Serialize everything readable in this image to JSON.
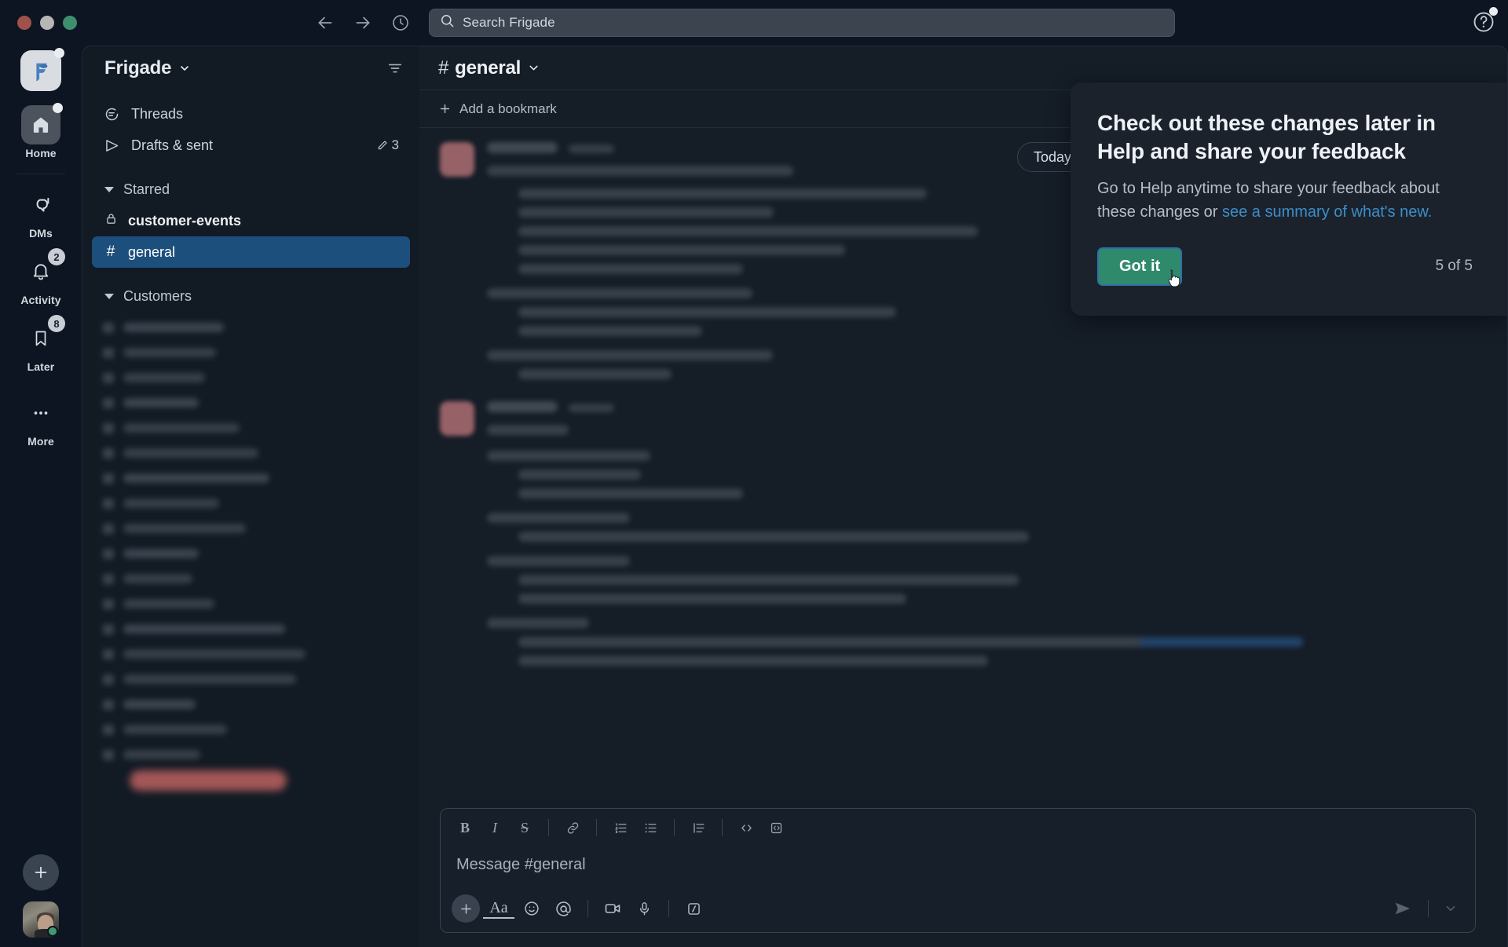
{
  "titlebar": {
    "nav": {
      "back_icon": "arrow-left-icon",
      "forward_icon": "arrow-right-icon",
      "history_icon": "clock-icon"
    },
    "search": {
      "placeholder": "Search Frigade",
      "icon": "search-icon"
    },
    "help": {
      "icon": "question-mark-icon"
    }
  },
  "rail": {
    "workspace": {
      "name": "Frigade",
      "icon": "frigade-logo-icon"
    },
    "items": [
      {
        "label": "Home",
        "icon": "home-icon",
        "badge": "",
        "dot": true,
        "active": true
      },
      {
        "label": "DMs",
        "icon": "dm-bubble-icon",
        "badge": "",
        "dot": false,
        "active": false
      },
      {
        "label": "Activity",
        "icon": "bell-icon",
        "badge": "2",
        "dot": false,
        "active": false
      },
      {
        "label": "Later",
        "icon": "bookmark-icon",
        "badge": "8",
        "dot": false,
        "active": false
      },
      {
        "label": "More",
        "icon": "ellipsis-icon",
        "badge": "",
        "dot": false,
        "active": false
      }
    ],
    "add_label": "+",
    "avatar_presence": "active"
  },
  "sidebar": {
    "title": "Frigade",
    "title_caret": "chevron-down-icon",
    "filter_icon": "filter-icon",
    "nav": [
      {
        "label": "Threads",
        "icon": "threads-icon",
        "count": ""
      },
      {
        "label": "Drafts & sent",
        "icon": "send-outline-icon",
        "count": "3",
        "count_icon": "pencil-icon"
      }
    ],
    "sections": [
      {
        "label": "Starred",
        "expanded": true,
        "channels": [
          {
            "name": "customer-events",
            "icon": "lock-icon",
            "bold": true,
            "selected": false
          },
          {
            "name": "general",
            "icon": "hash-icon",
            "bold": false,
            "selected": true
          }
        ]
      },
      {
        "label": "Customers",
        "expanded": true,
        "channels": []
      }
    ],
    "redacted_rows": 18
  },
  "channel": {
    "name": "general",
    "hash": "#",
    "caret": "chevron-down-icon",
    "bookmark_add_label": "Add a bookmark",
    "bookmark_add_icon": "plus-icon",
    "date_divider": "Today",
    "date_divider_caret": "chevron-down-icon"
  },
  "composer": {
    "placeholder": "Message #general",
    "format_buttons": [
      {
        "name": "bold",
        "glyph": "B"
      },
      {
        "name": "italic",
        "glyph": "I"
      },
      {
        "name": "strikethrough",
        "glyph": "S"
      },
      {
        "name": "link",
        "glyph": "link-icon"
      },
      {
        "name": "ordered-list",
        "glyph": "ordered-list-icon"
      },
      {
        "name": "bulleted-list",
        "glyph": "bulleted-list-icon"
      },
      {
        "name": "blockquote",
        "glyph": "blockquote-icon"
      },
      {
        "name": "code",
        "glyph": "code-icon"
      },
      {
        "name": "code-block",
        "glyph": "code-block-icon"
      }
    ],
    "action_buttons": [
      {
        "name": "attach",
        "glyph": "plus-icon"
      },
      {
        "name": "formatting",
        "glyph": "Aa"
      },
      {
        "name": "emoji",
        "glyph": "emoji-icon"
      },
      {
        "name": "mention",
        "glyph": "at-icon"
      },
      {
        "name": "video",
        "glyph": "video-icon"
      },
      {
        "name": "audio",
        "glyph": "microphone-icon"
      },
      {
        "name": "slash-command",
        "glyph": "slash-icon"
      }
    ],
    "send_icon": "send-icon",
    "send_options_icon": "chevron-down-icon"
  },
  "popup": {
    "title": "Check out these changes later in Help and share your feedback",
    "body_prefix": "Go to Help anytime to share your feedback about these changes or ",
    "link_text": "see a summary of what's new.",
    "button_label": "Got it",
    "counter": "5 of 5",
    "button_color": "#2f8a6c",
    "link_color": "#3d8ec9"
  }
}
